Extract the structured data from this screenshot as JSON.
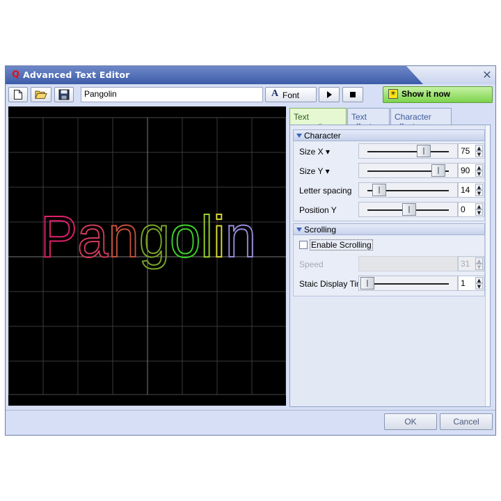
{
  "window": {
    "title": "Advanced Text Editor",
    "app_icon": "Q",
    "close_glyph": "✕"
  },
  "toolbar": {
    "text_value": "Pangolin",
    "font_glyph": "A",
    "font_label": "Font",
    "show_label": "Show it now"
  },
  "preview": {
    "text": "Pangolin",
    "letter_colors": [
      "#e0206a",
      "#d23c5a",
      "#c4503c",
      "#7aa52a",
      "#3fcf2a",
      "#9ad42a",
      "#d8d83a",
      "#9a8ad8"
    ]
  },
  "tabs": [
    {
      "label": "Text properties",
      "active": true
    },
    {
      "label": "Text effect",
      "active": false
    },
    {
      "label": "Character effect",
      "active": false
    }
  ],
  "character": {
    "header": "Character",
    "rows": [
      {
        "label": "Size X ▾",
        "value": "75",
        "level": 0.68
      },
      {
        "label": "Size Y ▾",
        "value": "90",
        "level": 0.86
      },
      {
        "label": "Letter spacing",
        "value": "14",
        "level": 0.14
      },
      {
        "label": "Position Y",
        "value": "0",
        "level": 0.5
      }
    ]
  },
  "scrolling": {
    "header": "Scrolling",
    "enable_label": "Enable Scrolling",
    "enabled": false,
    "speed_label": "Speed",
    "speed_value": "31",
    "static_label": "Staic Display Time",
    "static_value": "1",
    "static_level": 0.0
  },
  "footer": {
    "ok_label": "OK",
    "cancel_label": "Cancel"
  }
}
